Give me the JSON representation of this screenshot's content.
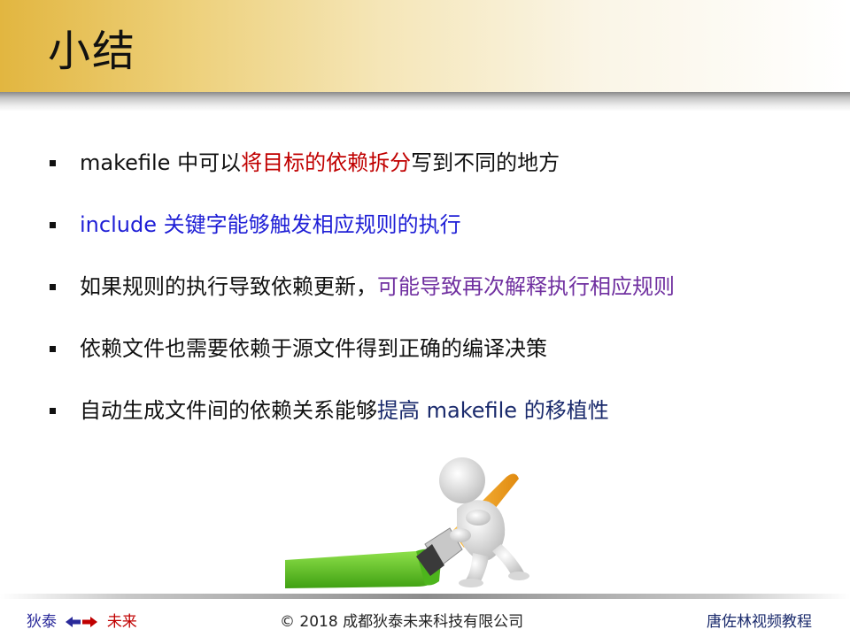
{
  "slide": {
    "title": "小结"
  },
  "bullets": [
    {
      "segments": [
        {
          "text": "makefile 中可以",
          "color": "#111111"
        },
        {
          "text": "将目标的依赖拆分",
          "color": "#c00000"
        },
        {
          "text": "写到不同的地方",
          "color": "#111111"
        }
      ]
    },
    {
      "segments": [
        {
          "text": "include 关键字能够触发相应规则的执行",
          "color": "#1f1fd6"
        }
      ]
    },
    {
      "segments": [
        {
          "text": "如果规则的执行导致依赖更新，",
          "color": "#111111"
        },
        {
          "text": "可能导致再次解释执行相应规则",
          "color": "#7030a0"
        }
      ]
    },
    {
      "segments": [
        {
          "text": "依赖文件也需要依赖于源文件得到正确的编译决策",
          "color": "#111111"
        }
      ]
    },
    {
      "segments": [
        {
          "text": "自动生成文件间的依赖关系能够",
          "color": "#111111"
        },
        {
          "text": "提高 makefile 的移植性",
          "color": "#1a2a6c"
        }
      ]
    }
  ],
  "footer": {
    "left_a": "狄泰",
    "left_b": "未来",
    "center": "© 2018 成都狄泰未来科技有限公司",
    "right": "唐佐林视频教程"
  },
  "colors": {
    "accent_gold": "#e2b640",
    "red": "#c00000",
    "blue": "#1f1fd6",
    "purple": "#7030a0",
    "navy": "#1a2a6c",
    "brush_orange": "#f0a020",
    "paint_green": "#5cc82a"
  },
  "icons": [
    "bullet-square-icon",
    "double-arrow-icon",
    "painter-figure-illustration"
  ]
}
